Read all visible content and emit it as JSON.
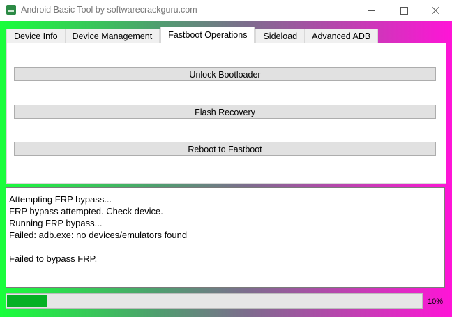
{
  "window": {
    "title": "Android Basic Tool by softwarecrackguru.com",
    "icon": "android-app-icon"
  },
  "tabs": [
    {
      "label": "Device Info",
      "active": false
    },
    {
      "label": "Device Management",
      "active": false
    },
    {
      "label": "Fastboot Operations",
      "active": true
    },
    {
      "label": "Sideload",
      "active": false
    },
    {
      "label": "Advanced ADB",
      "active": false
    }
  ],
  "fastboot": {
    "unlock_label": "Unlock Bootloader",
    "flash_recovery_label": "Flash Recovery",
    "reboot_label": "Reboot to Fastboot"
  },
  "log": {
    "lines": [
      "Attempting FRP bypass...",
      "FRP bypass attempted. Check device.",
      "Running FRP bypass...",
      "Failed: adb.exe: no devices/emulators found",
      "",
      "Failed to bypass FRP."
    ]
  },
  "progress": {
    "value": 0.1,
    "label": "10%"
  },
  "colors": {
    "progress_fill": "#06b025",
    "gradient_left": "#19ff3b",
    "gradient_right": "#ff14d7"
  }
}
